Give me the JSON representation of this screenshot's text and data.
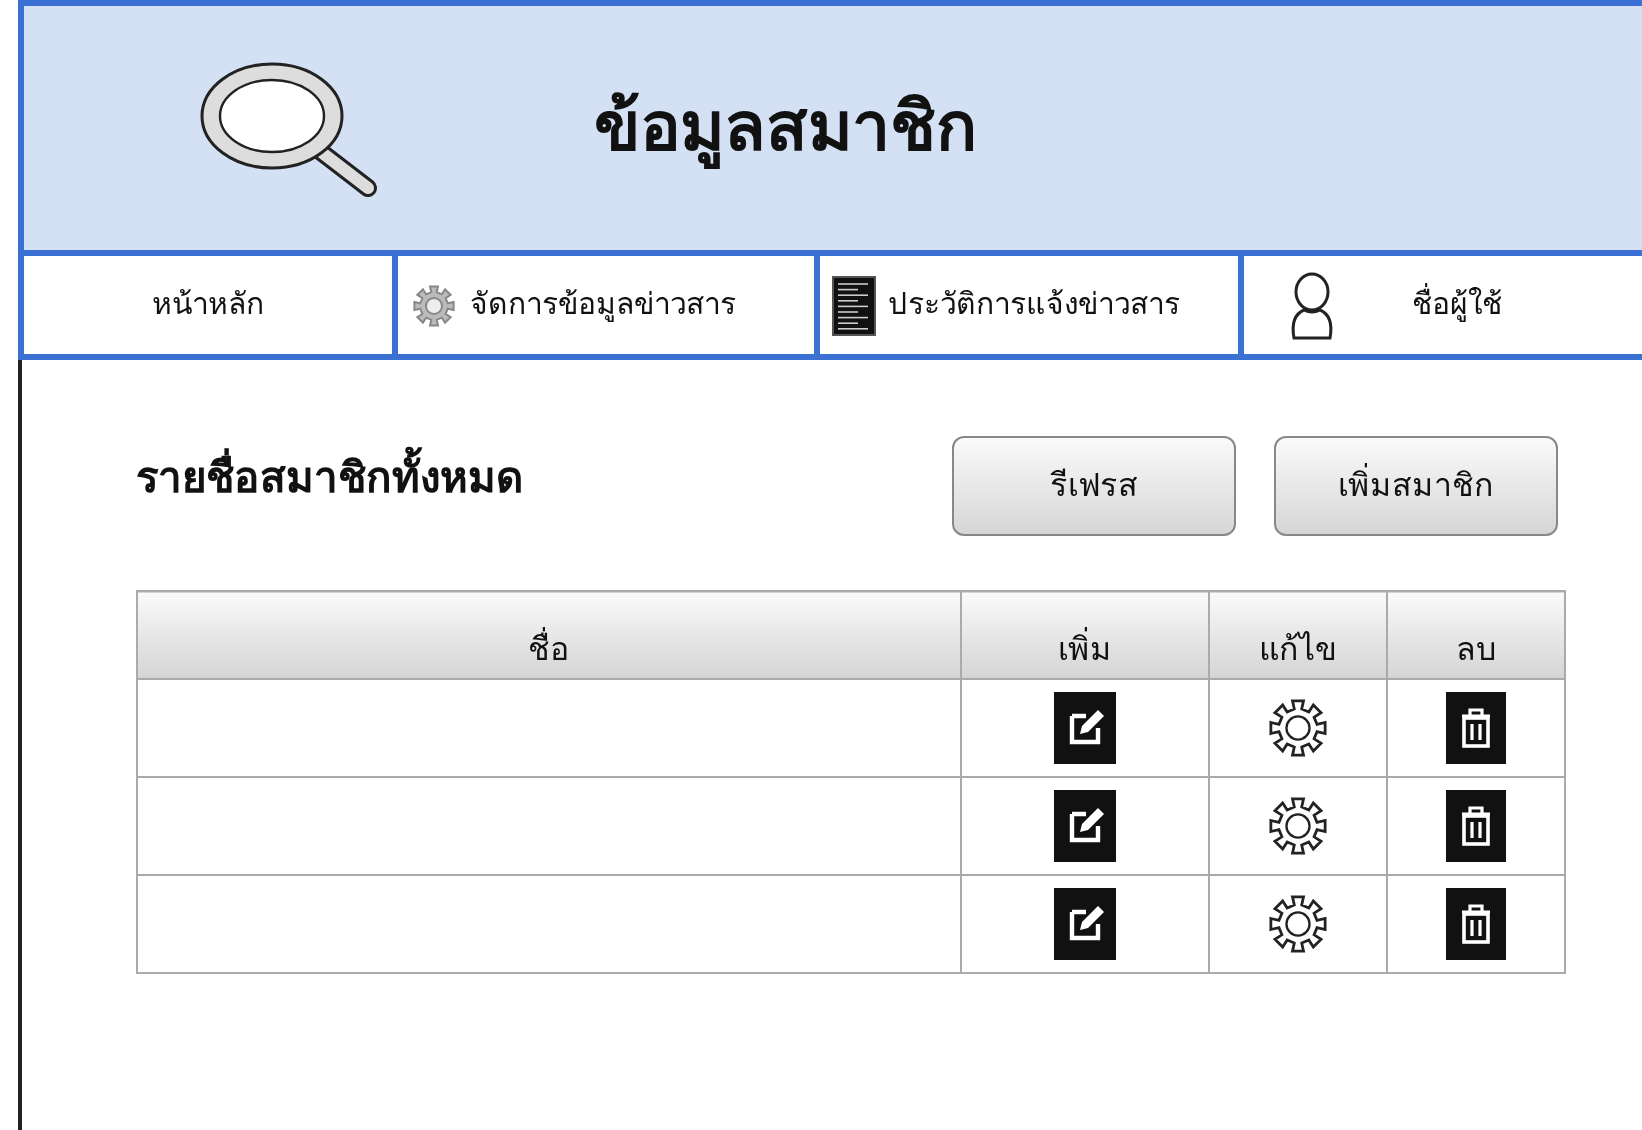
{
  "header": {
    "title": "ข้อมูลสมาชิก"
  },
  "nav": [
    {
      "label": "หน้าหลัก",
      "kind": "plain"
    },
    {
      "label": "จัดการข้อมูลข่าวสาร",
      "kind": "settings"
    },
    {
      "label": "ประวัติการแจ้งข่าวสาร",
      "kind": "history"
    },
    {
      "label": "ชื่อผู้ใช้",
      "kind": "account"
    }
  ],
  "section_title": "รายชื่อสมาชิกทั้งหมด",
  "buttons": [
    "รีเฟรส",
    "เพิ่มสมาชิก"
  ],
  "table": {
    "columns": [
      "ชื่อ",
      "เพิ่ม",
      "แก้ไข",
      "ลบ"
    ],
    "rows": [
      {
        "kind": "member"
      },
      {
        "kind": "member"
      },
      {
        "kind": "member"
      }
    ]
  }
}
